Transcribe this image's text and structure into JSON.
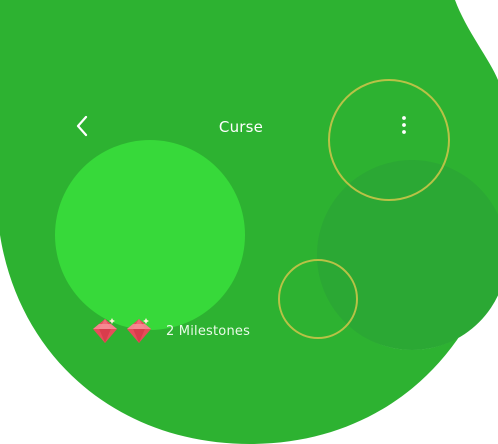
{
  "header": {
    "title": "Curse"
  },
  "milestones": {
    "label": "2 Milestones",
    "gem_count": 2
  },
  "icons": {
    "back": "chevron-left-icon",
    "menu": "more-vertical-icon",
    "gem": "ruby-gem-icon"
  },
  "colors": {
    "background_green": "#2DB231",
    "light_green_circle": "#37D93A",
    "dark_green_circle": "#2BA834",
    "ring_outline": "#B8C246",
    "gem_red": "#E84C5A"
  }
}
